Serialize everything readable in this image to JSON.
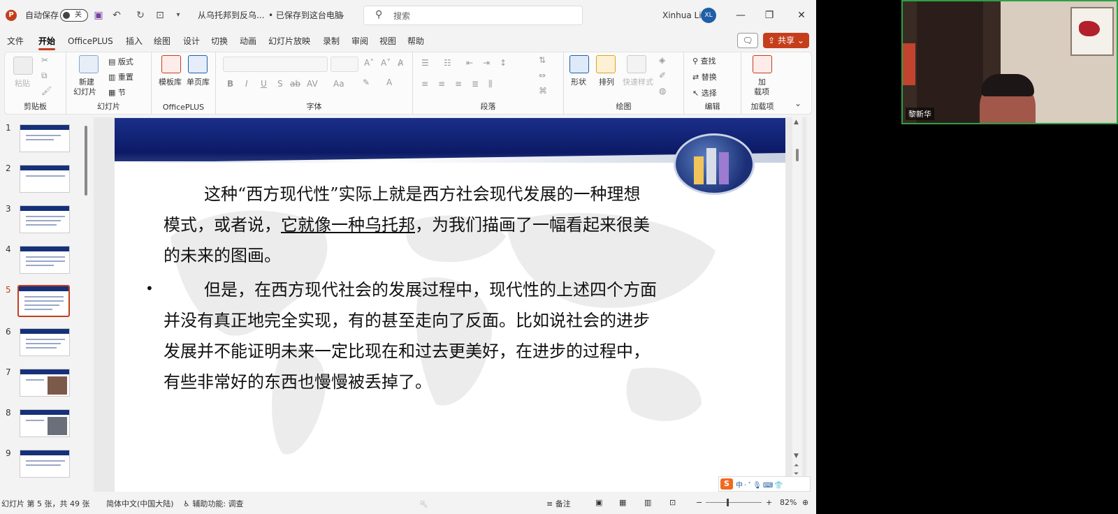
{
  "titlebar": {
    "autosave_label": "自动保存",
    "autosave_state": "关",
    "doc_name": "从乌托邦到反乌...",
    "save_status": "• 已保存到这台电脑",
    "search_placeholder": "搜索",
    "user_name": "Xinhua Li",
    "user_initials": "XL"
  },
  "menu": {
    "tabs": [
      "文件",
      "开始",
      "OfficePLUS",
      "插入",
      "绘图",
      "设计",
      "切换",
      "动画",
      "幻灯片放映",
      "录制",
      "审阅",
      "视图",
      "帮助"
    ],
    "active_tab": "开始",
    "share_label": "共享"
  },
  "ribbon": {
    "clipboard": {
      "paste": "粘贴",
      "group": "剪贴板"
    },
    "slides": {
      "new_slide": "新建",
      "new_slide2": "幻灯片",
      "layout": "版式",
      "reset": "重置",
      "section": "节",
      "group": "幻灯片"
    },
    "officeplus": {
      "template": "模板库",
      "single": "单页库",
      "group": "OfficePLUS"
    },
    "font": {
      "group": "字体"
    },
    "paragraph": {
      "group": "段落"
    },
    "drawing": {
      "shape": "形状",
      "arrange": "排列",
      "quick_style": "快速样式",
      "group": "绘图"
    },
    "editing": {
      "find": "查找",
      "replace": "替换",
      "select": "选择",
      "group": "编辑"
    },
    "addins": {
      "addin": "加",
      "addin2": "载项",
      "group": "加载项"
    }
  },
  "thumbnails": {
    "numbers": [
      "1",
      "2",
      "3",
      "4",
      "5",
      "6",
      "7",
      "8",
      "9"
    ],
    "selected": "5"
  },
  "slide": {
    "para1_line1": "这种“西方现代性”实际上就是西方社会现代发展的一种理想",
    "para1_line2_a": "模式，或者说，",
    "para1_line2_u": "它就像一种乌托邦",
    "para1_line2_b": "，为我们描画了一幅看起来很美",
    "para1_line3": "的未来的图画。",
    "bullet": "•",
    "para2_line1": "但是，在西方现代社会的发展过程中，现代性的上述四个方面",
    "para2_line2": "并没有真正地完全实现，有的甚至走向了反面。比如说社会的进步",
    "para2_line3": "发展并不能证明未来一定比现在和过去更美好，在进步的过程中，",
    "para2_line4": "有些非常好的东西也慢慢被丢掉了。"
  },
  "statusbar": {
    "slide_info": "幻灯片 第 5 张，共 49 张",
    "language": "简体中文(中国大陆)",
    "accessibility": "辅助功能: 调查",
    "notes": "备注",
    "zoom": "82%"
  },
  "ime": {
    "logo": "S",
    "items": "中·ˇ🎙⌨👕"
  },
  "webcam": {
    "name": "黎新华"
  },
  "colors": {
    "accent": "#c43e1c",
    "slide_header": "#16307a",
    "webcam_border": "#2ea043"
  }
}
